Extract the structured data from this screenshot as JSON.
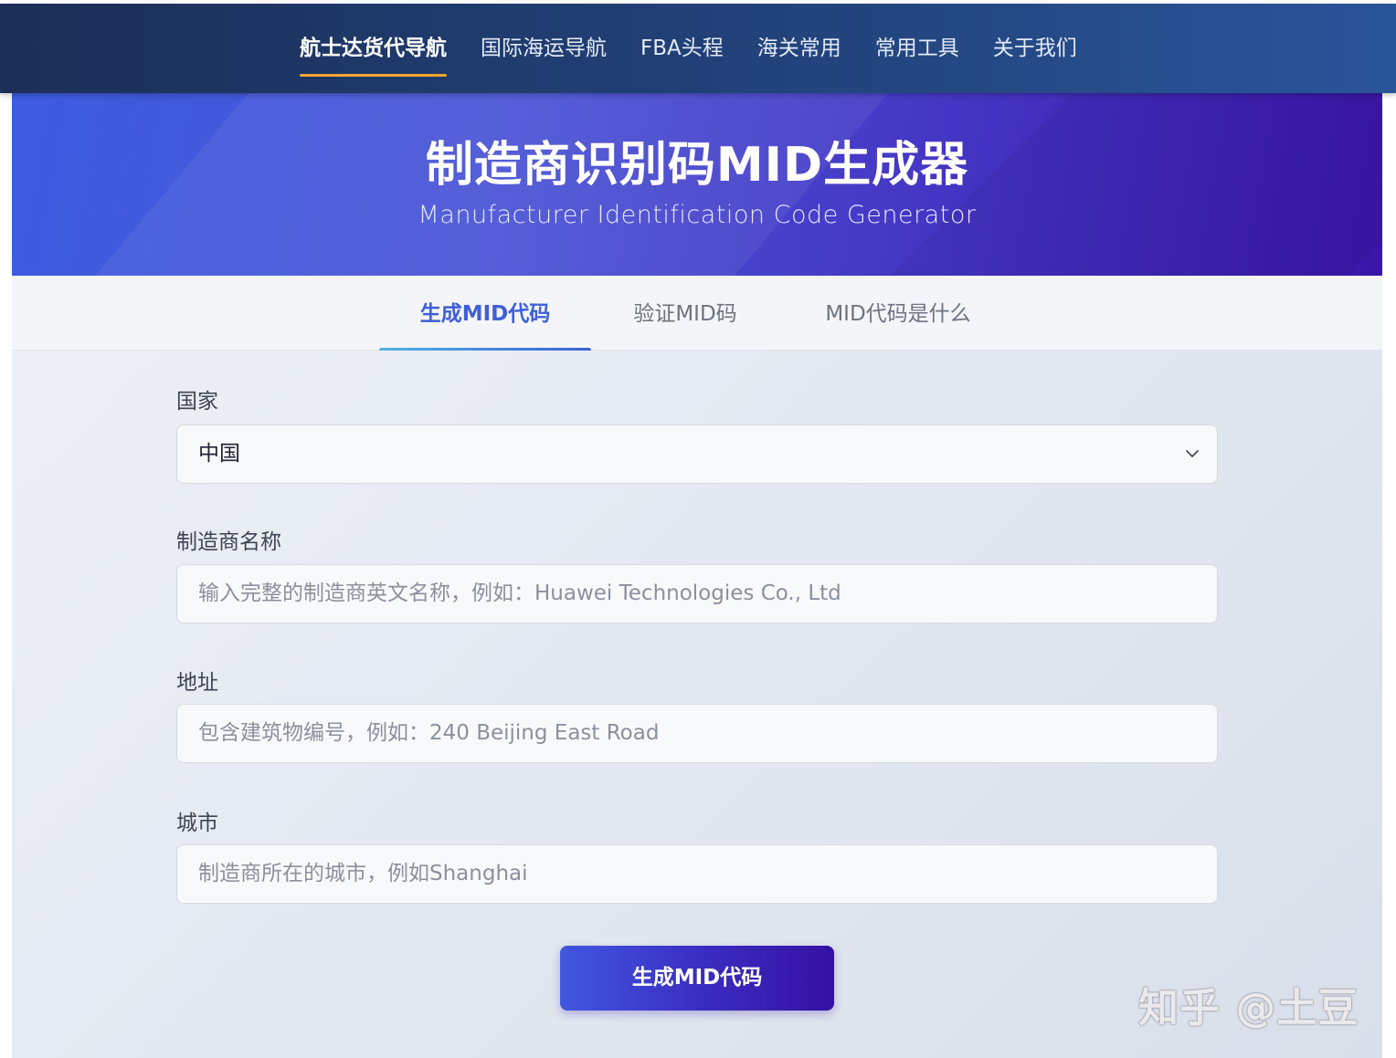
{
  "nav": {
    "items": [
      {
        "label": "航士达货代导航"
      },
      {
        "label": "国际海运导航"
      },
      {
        "label": "FBA头程"
      },
      {
        "label": "海关常用"
      },
      {
        "label": "常用工具"
      },
      {
        "label": "关于我们"
      }
    ]
  },
  "hero": {
    "title": "制造商识别码MID生成器",
    "subtitle": "Manufacturer Identification Code Generator"
  },
  "tabs": [
    {
      "label": "生成MID代码"
    },
    {
      "label": "验证MID码"
    },
    {
      "label": "MID代码是什么"
    }
  ],
  "form": {
    "country": {
      "label": "国家",
      "value": "中国"
    },
    "manufacturer": {
      "label": "制造商名称",
      "placeholder": "输入完整的制造商英文名称，例如：Huawei Technologies Co., Ltd"
    },
    "address": {
      "label": "地址",
      "placeholder": "包含建筑物编号，例如：240 Beijing East Road"
    },
    "city": {
      "label": "城市",
      "placeholder": "制造商所在的城市，例如Shanghai"
    },
    "submit_label": "生成MID代码"
  },
  "watermark": "知乎 @土豆",
  "colors": {
    "nav_bg": "#22427a",
    "nav_active_underline": "#f0a92e",
    "hero_start": "#3d5ce0",
    "hero_end": "#3a16a8",
    "tab_active": "#3f5fd8",
    "button_start": "#4157df",
    "button_end": "#3511a3"
  }
}
